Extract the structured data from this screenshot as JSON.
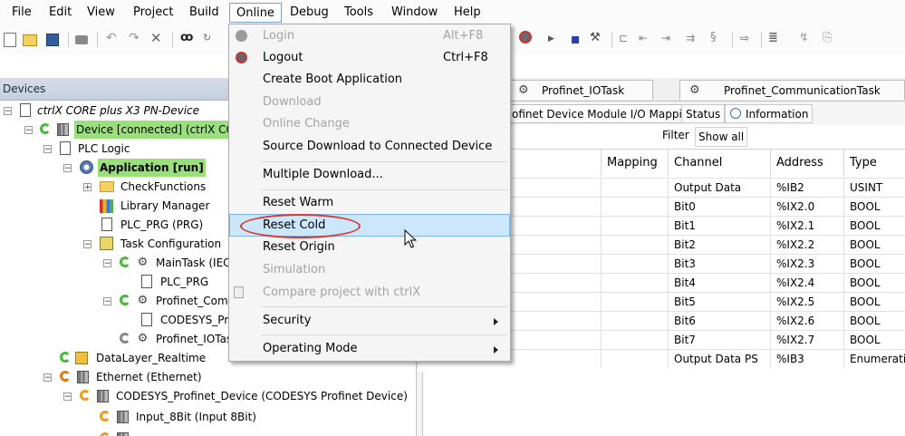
{
  "menubar": {
    "items": [
      "File",
      "Edit",
      "View",
      "Project",
      "Build",
      "Online",
      "Debug",
      "Tools",
      "Window",
      "Help"
    ],
    "open_item": "Online"
  },
  "toolbar": {
    "icons": [
      "new-project-icon",
      "open-project-icon",
      "save-icon",
      "print-icon",
      "undo-icon",
      "redo-icon",
      "cut-icon",
      "find-icon",
      "replace-icon"
    ]
  },
  "devices": {
    "header": "Devices",
    "tree": [
      {
        "label": "ctrlX CORE plus X3 PN-Device",
        "italic": true
      },
      {
        "label": "Device [connected] (ctrlX CORE",
        "highlight": true
      },
      {
        "label": "PLC Logic"
      },
      {
        "label": "Application [run]",
        "highlight": true,
        "bold": true
      },
      {
        "label": "CheckFunctions"
      },
      {
        "label": "Library Manager"
      },
      {
        "label": "PLC_PRG (PRG)"
      },
      {
        "label": "Task Configuration"
      },
      {
        "label": "MainTask (IEC"
      },
      {
        "label": "PLC_PRG"
      },
      {
        "label": "Profinet_Comm"
      },
      {
        "label": "CODESYS_Pro"
      },
      {
        "label": "Profinet_IOTas"
      },
      {
        "label": "DataLayer_Realtime"
      },
      {
        "label": "Ethernet (Ethernet)"
      },
      {
        "label": "CODESYS_Profinet_Device (CODESYS Profinet Device)"
      },
      {
        "label": "Input_8Bit (Input 8Bit)"
      }
    ]
  },
  "editor": {
    "tabs": [
      "Profinet_IOTask",
      "Profinet_CommunicationTask"
    ],
    "subtabs": [
      "ofinet Device Module I/O Mapping",
      "Status",
      "Information"
    ],
    "filter_label": "Filter",
    "filter_value": "Show all",
    "columns": [
      "Mapping",
      "Channel",
      "Address",
      "Type"
    ],
    "rows": [
      {
        "channel": "Output Data",
        "address": "%IB2",
        "type": "USINT"
      },
      {
        "channel": "Bit0",
        "address": "%IX2.0",
        "type": "BOOL"
      },
      {
        "channel": "Bit1",
        "address": "%IX2.1",
        "type": "BOOL"
      },
      {
        "channel": "Bit2",
        "address": "%IX2.2",
        "type": "BOOL"
      },
      {
        "channel": "Bit3",
        "address": "%IX2.3",
        "type": "BOOL"
      },
      {
        "channel": "Bit4",
        "address": "%IX2.4",
        "type": "BOOL"
      },
      {
        "channel": "Bit5",
        "address": "%IX2.5",
        "type": "BOOL"
      },
      {
        "channel": "Bit6",
        "address": "%IX2.6",
        "type": "BOOL"
      },
      {
        "channel": "Bit7",
        "address": "%IX2.7",
        "type": "BOOL"
      },
      {
        "channel": "Output Data PS",
        "address": "%IB3",
        "type": "Enumeration"
      }
    ]
  },
  "online_menu": {
    "items": [
      {
        "label": "Login",
        "shortcut": "Alt+F8",
        "disabled": true
      },
      {
        "label": "Logout",
        "shortcut": "Ctrl+F8",
        "disabled": false
      },
      {
        "label": "Create Boot Application",
        "shortcut": "",
        "disabled": false
      },
      {
        "label": "Download",
        "shortcut": "",
        "disabled": true
      },
      {
        "label": "Online Change",
        "shortcut": "",
        "disabled": true
      },
      {
        "label": "Source Download to Connected Device",
        "shortcut": "",
        "disabled": false
      },
      {
        "label": "Multiple Download...",
        "shortcut": "",
        "disabled": false
      },
      {
        "label": "Reset Warm",
        "shortcut": "",
        "disabled": false
      },
      {
        "label": "Reset Cold",
        "shortcut": "",
        "disabled": false,
        "selected": true
      },
      {
        "label": "Reset Origin",
        "shortcut": "",
        "disabled": false
      },
      {
        "label": "Simulation",
        "shortcut": "",
        "disabled": true
      },
      {
        "label": "Compare project with ctrlX",
        "shortcut": "",
        "disabled": true
      },
      {
        "label": "Security",
        "shortcut": "",
        "disabled": false,
        "submenu": true
      },
      {
        "label": "Operating Mode",
        "shortcut": "",
        "disabled": false,
        "submenu": true
      }
    ]
  },
  "colors": {
    "highlight": "#99e07a",
    "selected": "#cce6fb",
    "annotation": "#d63a33"
  }
}
